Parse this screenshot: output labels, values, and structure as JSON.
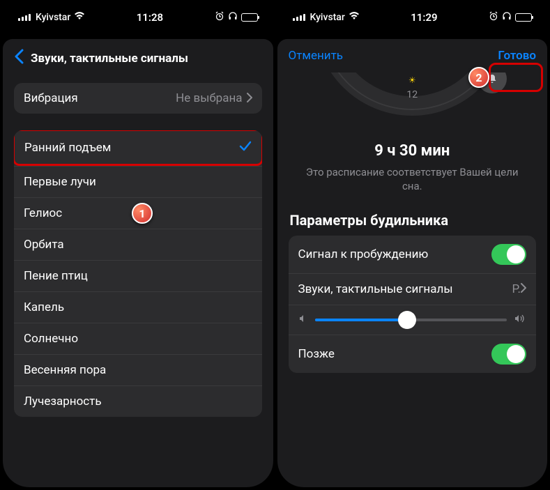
{
  "status": {
    "carrier": "Kyivstar",
    "time": "11:28",
    "time2": "11:29"
  },
  "left": {
    "title": "Звуки, тактильные сигналы",
    "vibration_label": "Вибрация",
    "vibration_value": "Не выбрана",
    "sounds": [
      "Ранний подъем",
      "Первые лучи",
      "Гелиос",
      "Орбита",
      "Пение птиц",
      "Капель",
      "Солнечно",
      "Весенняя пора",
      "Лучезарность"
    ],
    "selected_index": 0
  },
  "right": {
    "cancel": "Отменить",
    "done": "Готово",
    "dial_number": "12",
    "duration": "9 ч 30 мин",
    "duration_sub": "Это расписание соответствует Вашей цели сна.",
    "alarm_header": "Параметры будильника",
    "wake_signal": "Сигнал к пробуждению",
    "sounds_row": "Звуки, тактильные сигналы",
    "sounds_value": "Р.",
    "snooze": "Позже",
    "volume_percent": 48
  },
  "markers": {
    "one": "1",
    "two": "2"
  }
}
